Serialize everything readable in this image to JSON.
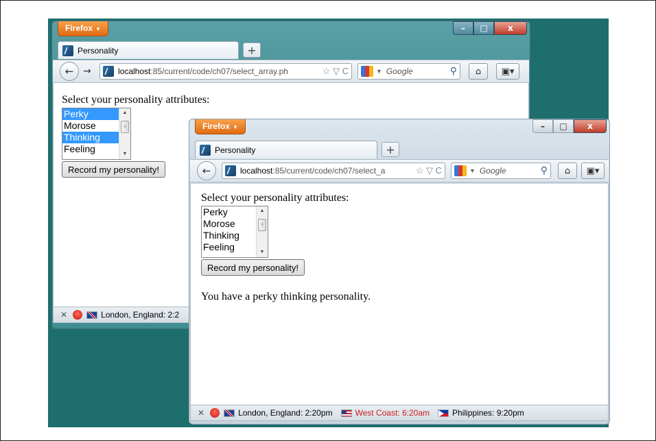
{
  "browser_button_label": "Firefox",
  "window_controls": {
    "minimize": "–",
    "maximize": "□",
    "close": "x"
  },
  "back_window": {
    "tab_title": "Personality",
    "url_host": "localhost",
    "url_path": ":85/current/code/ch07/select_array.ph",
    "search_placeholder": "Google",
    "form_label": "Select your personality attributes:",
    "options": [
      "Perky",
      "Morose",
      "Thinking",
      "Feeling"
    ],
    "selected": [
      "Perky",
      "Thinking"
    ],
    "submit_label": "Record my personality!",
    "status": {
      "london": "London, England: 2:2"
    }
  },
  "front_window": {
    "tab_title": "Personality",
    "url_host": "localhost",
    "url_path": ":85/current/code/ch07/select_a",
    "search_placeholder": "Google",
    "form_label": "Select your personality attributes:",
    "options": [
      "Perky",
      "Morose",
      "Thinking",
      "Feeling"
    ],
    "submit_label": "Record my personality!",
    "result_text": "You have a perky thinking personality.",
    "status": {
      "london": "London, England: 2:20pm",
      "west_coast": "West Coast: 6:20am",
      "philippines": "Philippines: 9:20pm"
    }
  },
  "icons": [
    "back-arrow",
    "forward-arrow",
    "reload",
    "bookmark-star",
    "home",
    "bookmarks-menu",
    "search-magnifier",
    "weather",
    "flag-uk",
    "flag-us",
    "flag-ph"
  ],
  "colors": {
    "desktop": "#1d6e6c",
    "firefox_orange": "#e06a13",
    "selection": "#3399ff"
  }
}
